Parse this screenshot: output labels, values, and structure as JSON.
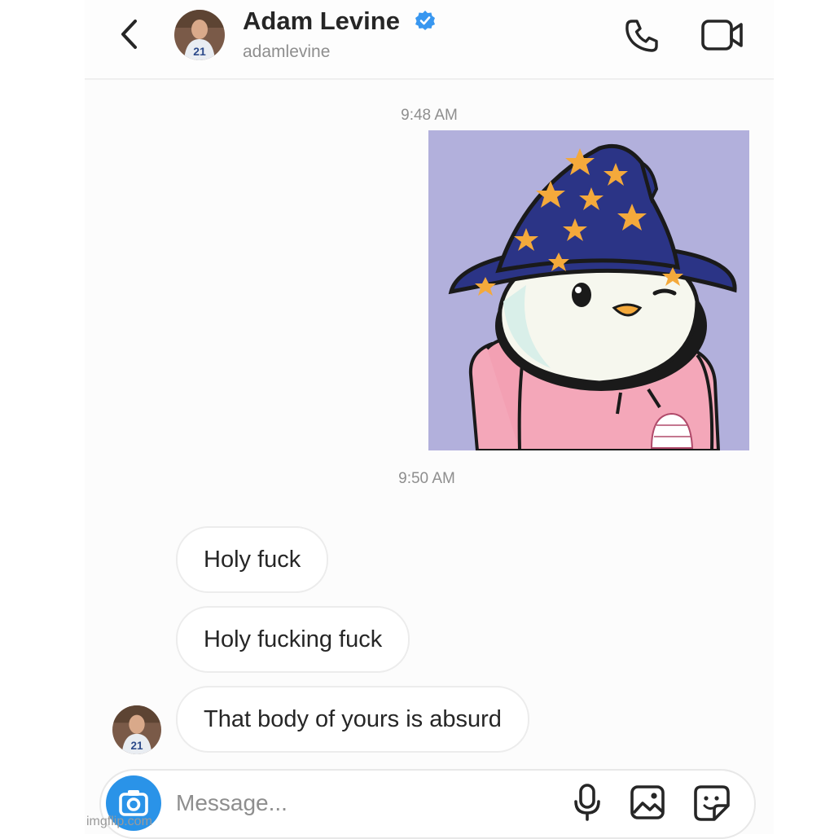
{
  "header": {
    "name": "Adam Levine",
    "username": "adamlevine",
    "verified": true,
    "back_icon": "chevron-left-icon",
    "call_icon": "phone-icon",
    "video_icon": "video-camera-icon"
  },
  "messages": {
    "time_1": "9:48 AM",
    "image_description": "penguin-wizard-hat-pink-hoodie-illustration",
    "time_2": "9:50 AM",
    "bubbles": [
      {
        "text": "Holy fuck"
      },
      {
        "text": "Holy fucking fuck"
      },
      {
        "text": "That body of yours is absurd"
      }
    ]
  },
  "composer": {
    "placeholder": "Message...",
    "camera_icon": "camera-icon",
    "mic_icon": "microphone-icon",
    "gallery_icon": "gallery-icon",
    "sticker_icon": "sticker-icon"
  },
  "watermark": "imgflip.com",
  "colors": {
    "accent_blue": "#2a93e8",
    "verified_blue": "#3897f0",
    "image_bg": "#b2b0dc",
    "hat_blue": "#2b3486",
    "star_orange": "#f4a93b",
    "hoodie_pink": "#f4a7b9"
  }
}
